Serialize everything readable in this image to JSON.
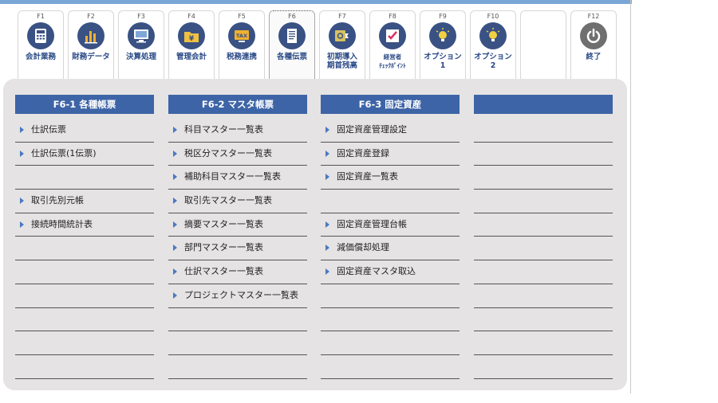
{
  "fkeys": [
    {
      "key": "F1",
      "label": "会計業務",
      "label2": "",
      "icon": "calculator-icon",
      "color": "#3a5184"
    },
    {
      "key": "F2",
      "label": "財務データ",
      "label2": "",
      "icon": "bar-chart-icon",
      "color": "#3a5184"
    },
    {
      "key": "F3",
      "label": "決算処理",
      "label2": "",
      "icon": "monitor-icon",
      "color": "#3a5184"
    },
    {
      "key": "F4",
      "label": "管理会計",
      "label2": "",
      "icon": "yen-folder-icon",
      "color": "#3a5184"
    },
    {
      "key": "F5",
      "label": "税務連携",
      "label2": "",
      "icon": "tax-screen-icon",
      "color": "#3a5184"
    },
    {
      "key": "F6",
      "label": "各種伝票",
      "label2": "",
      "icon": "document-icon",
      "color": "#3a5184"
    },
    {
      "key": "F7",
      "label": "初期導入",
      "label2": "期首残高",
      "icon": "safe-import-icon",
      "color": "#3a5184"
    },
    {
      "key": "F8",
      "label": "経営者",
      "label2": "ﾁｪｯｸﾎﾟｲﾝﾄ",
      "icon": "checkbox-icon",
      "color": "#3a5184"
    },
    {
      "key": "F9",
      "label": "オプション",
      "label2": "1",
      "icon": "lightbulb-icon",
      "color": "#3a5184"
    },
    {
      "key": "F10",
      "label": "オプション",
      "label2": "2",
      "icon": "lightbulb-icon",
      "color": "#3a5184"
    },
    {
      "key": "",
      "label": "",
      "label2": "",
      "icon": "",
      "color": ""
    },
    {
      "key": "F12",
      "label": "終了",
      "label2": "",
      "icon": "power-icon",
      "color": "#6f6f6f"
    }
  ],
  "columns": [
    {
      "title": "F6-1 各種帳票",
      "rows": [
        "仕訳伝票",
        "仕訳伝票(1伝票)",
        "",
        "取引先別元帳",
        "接続時間統計表",
        "",
        "",
        "",
        "",
        "",
        ""
      ]
    },
    {
      "title": "F6-2 マスタ帳票",
      "rows": [
        "科目マスター一覧表",
        "税区分マスター一覧表",
        "補助科目マスター一覧表",
        "取引先マスター一覧表",
        "摘要マスター一覧表",
        "部門マスター一覧表",
        "仕訳マスター一覧表",
        "プロジェクトマスター一覧表",
        "",
        "",
        ""
      ]
    },
    {
      "title": "F6-3 固定資産",
      "rows": [
        "固定資産管理設定",
        "固定資産登録",
        "固定資産一覧表",
        "",
        "固定資産管理台帳",
        "減価償却処理",
        "固定資産マスタ取込",
        "",
        "",
        "",
        ""
      ]
    },
    {
      "title": "",
      "rows": [
        "",
        "",
        "",
        "",
        "",
        "",
        "",
        "",
        "",
        "",
        ""
      ]
    }
  ]
}
